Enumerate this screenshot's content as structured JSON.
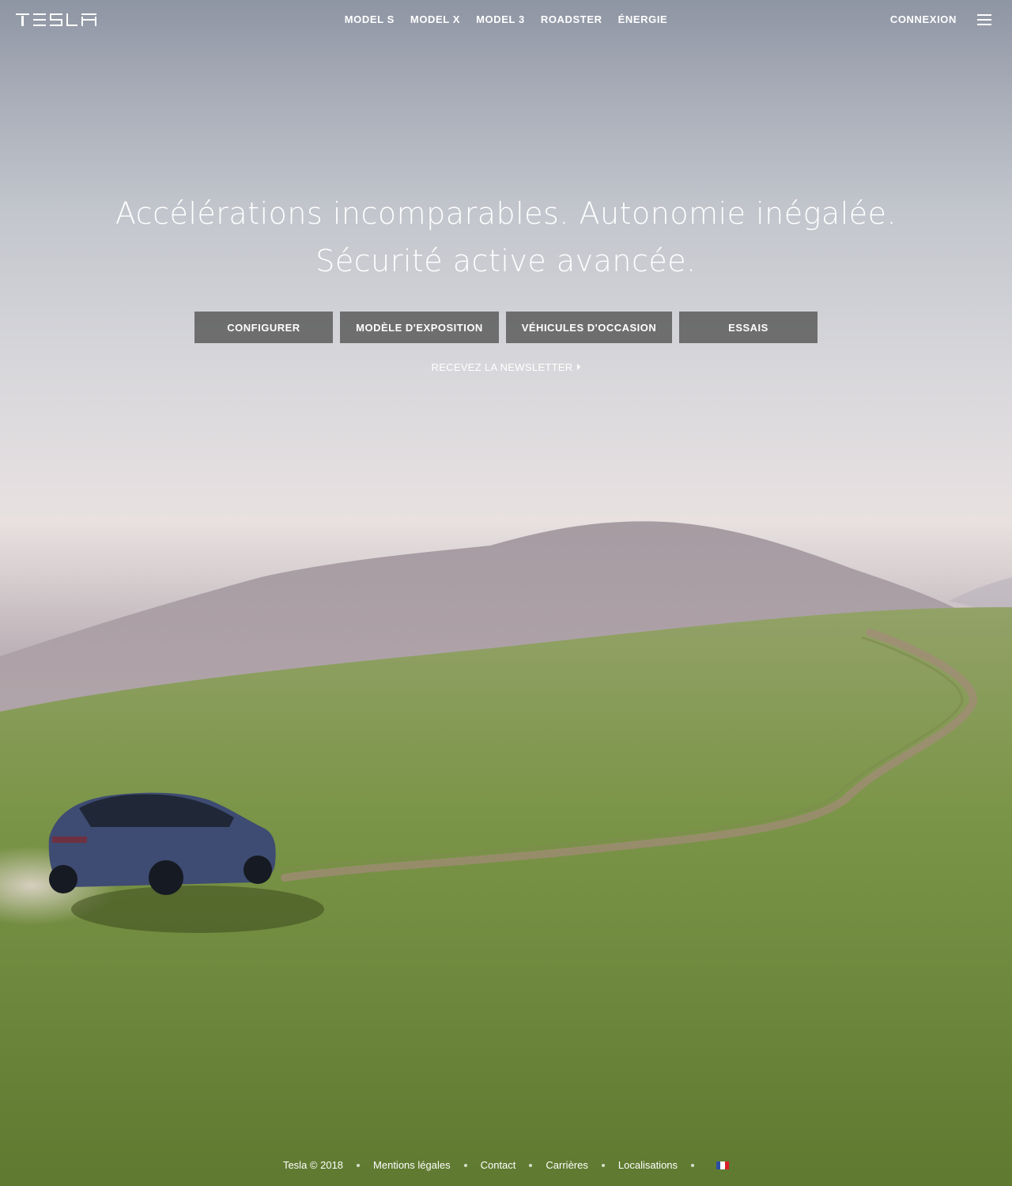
{
  "header": {
    "logo": "TESLA",
    "nav": [
      {
        "label": "MODEL S"
      },
      {
        "label": "MODEL X"
      },
      {
        "label": "MODEL 3"
      },
      {
        "label": "ROADSTER"
      },
      {
        "label": "ÉNERGIE"
      }
    ],
    "login_label": "CONNEXION",
    "menu_icon": "hamburger-menu-icon"
  },
  "hero": {
    "title_line1": "Accélérations incomparables. Autonomie inégalée.",
    "title_line2": "Sécurité active avancée.",
    "buttons": [
      {
        "label": "CONFIGURER"
      },
      {
        "label": "MODÈLE D'EXPOSITION"
      },
      {
        "label": "VÉHICULES D'OCCASION"
      },
      {
        "label": "ESSAIS"
      }
    ],
    "newsletter_label": "RECEVEZ LA NEWSLETTER",
    "newsletter_icon": "caret-right-icon"
  },
  "footer": {
    "copyright": "Tesla © 2018",
    "links": [
      {
        "label": "Mentions légales"
      },
      {
        "label": "Contact"
      },
      {
        "label": "Carrières"
      },
      {
        "label": "Localisations"
      }
    ],
    "locale_icon": "france-flag-icon"
  },
  "colors": {
    "button_bg": "#5c5c5c",
    "text": "#ffffff",
    "grass": "#7a9446",
    "sky": "#c3c6cd",
    "flag_blue": "#2b4ea2",
    "flag_white": "#ffffff",
    "flag_red": "#d8202a"
  }
}
